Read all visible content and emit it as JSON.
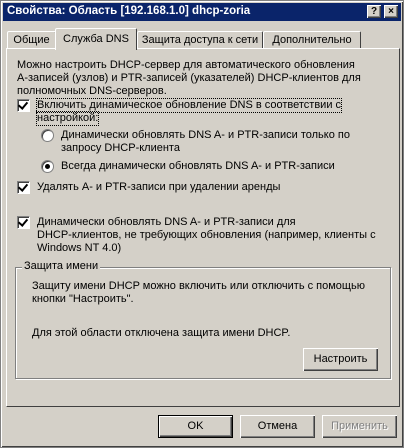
{
  "window": {
    "title": "Свойства: Область [192.168.1.0] dhcp-zoria",
    "help_glyph": "?",
    "close_glyph": "×"
  },
  "tabs": [
    {
      "label": "Общие"
    },
    {
      "label": "Служба DNS"
    },
    {
      "label": "Защита доступа к сети"
    },
    {
      "label": "Дополнительно"
    }
  ],
  "dns": {
    "description": [
      "Можно настроить DHCP-сервер для автоматического обновления",
      "A-записей (узлов) и PTR-записей (указателей) DHCP-клиентов для",
      "полномочных DNS-серверов."
    ],
    "enable_dynamic": {
      "line1": "Включить динамическое обновление DNS в соответствии с",
      "line2": "настройкой:",
      "checked": true
    },
    "radio_on_request": {
      "line1": "Динамически обновлять DNS A- и PTR-записи только по",
      "line2": "запросу DHCP-клиента",
      "selected": false
    },
    "radio_always": {
      "label": "Всегда динамически обновлять DNS A- и PTR-записи",
      "selected": true
    },
    "delete_on_expire": {
      "label": "Удалять A- и PTR-записи при удалении аренды",
      "checked": true
    },
    "update_legacy": {
      "line1": "Динамически обновлять DNS A- и PTR-записи для",
      "line2": "DHCP-клиентов, не требующих обновления (например, клиенты с",
      "line3": "Windows NT 4.0)",
      "checked": true
    }
  },
  "name_protection": {
    "title": "Защита имени",
    "desc_line1": "Защиту имени DHCP можно включить или отключить с помощью",
    "desc_line2": "кнопки \"Настроить\".",
    "status": "Для этой области отключена защита имени DHCP.",
    "configure_button": "Настроить"
  },
  "buttons": {
    "ok": "OK",
    "cancel": "Отмена",
    "apply": "Применить"
  },
  "colors": {
    "titlebar": "#0a246a",
    "face": "#d4d0c8"
  }
}
